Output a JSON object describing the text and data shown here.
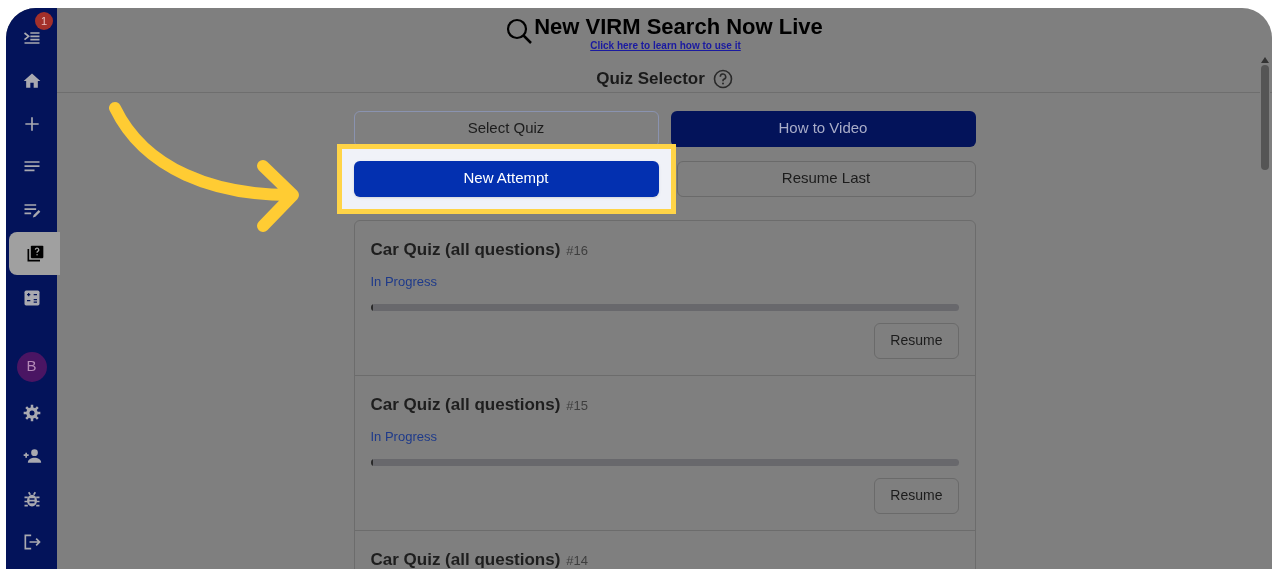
{
  "banner": {
    "title": "New VIRM Search Now Live",
    "link": "Click here to learn how to use it"
  },
  "page_title": "Quiz Selector",
  "sidebar": {
    "items": [
      {
        "kind": "icon",
        "selected": false,
        "badge": "1"
      },
      {
        "kind": "icon",
        "selected": false
      },
      {
        "kind": "icon",
        "selected": false
      },
      {
        "kind": "icon",
        "selected": false
      },
      {
        "kind": "icon",
        "selected": false
      },
      {
        "kind": "icon",
        "selected": true
      },
      {
        "kind": "icon",
        "selected": false
      },
      {
        "kind": "avatar",
        "selected": false,
        "label": "B"
      },
      {
        "kind": "icon",
        "selected": false
      },
      {
        "kind": "icon",
        "selected": false
      },
      {
        "kind": "icon",
        "selected": false
      },
      {
        "kind": "icon",
        "selected": false
      }
    ]
  },
  "button_rows": [
    [
      {
        "label": "Select Quiz",
        "kind": "outline",
        "highlighted": false
      },
      {
        "label": "How to Video",
        "kind": "filled",
        "highlighted": false
      }
    ],
    [
      {
        "label": "New Attempt",
        "kind": "primary",
        "highlighted": true
      },
      {
        "label": "Resume Last",
        "kind": "outline",
        "highlighted": false
      }
    ]
  ],
  "attempts": [
    {
      "title": "Car Quiz (all questions)",
      "number": "#16",
      "status": "In Progress",
      "level": 0.004,
      "action": "Resume"
    },
    {
      "title": "Car Quiz (all questions)",
      "number": "#15",
      "status": "In Progress",
      "level": 0.004,
      "action": "Resume"
    },
    {
      "title": "Car Quiz (all questions)",
      "number": "#14"
    }
  ]
}
